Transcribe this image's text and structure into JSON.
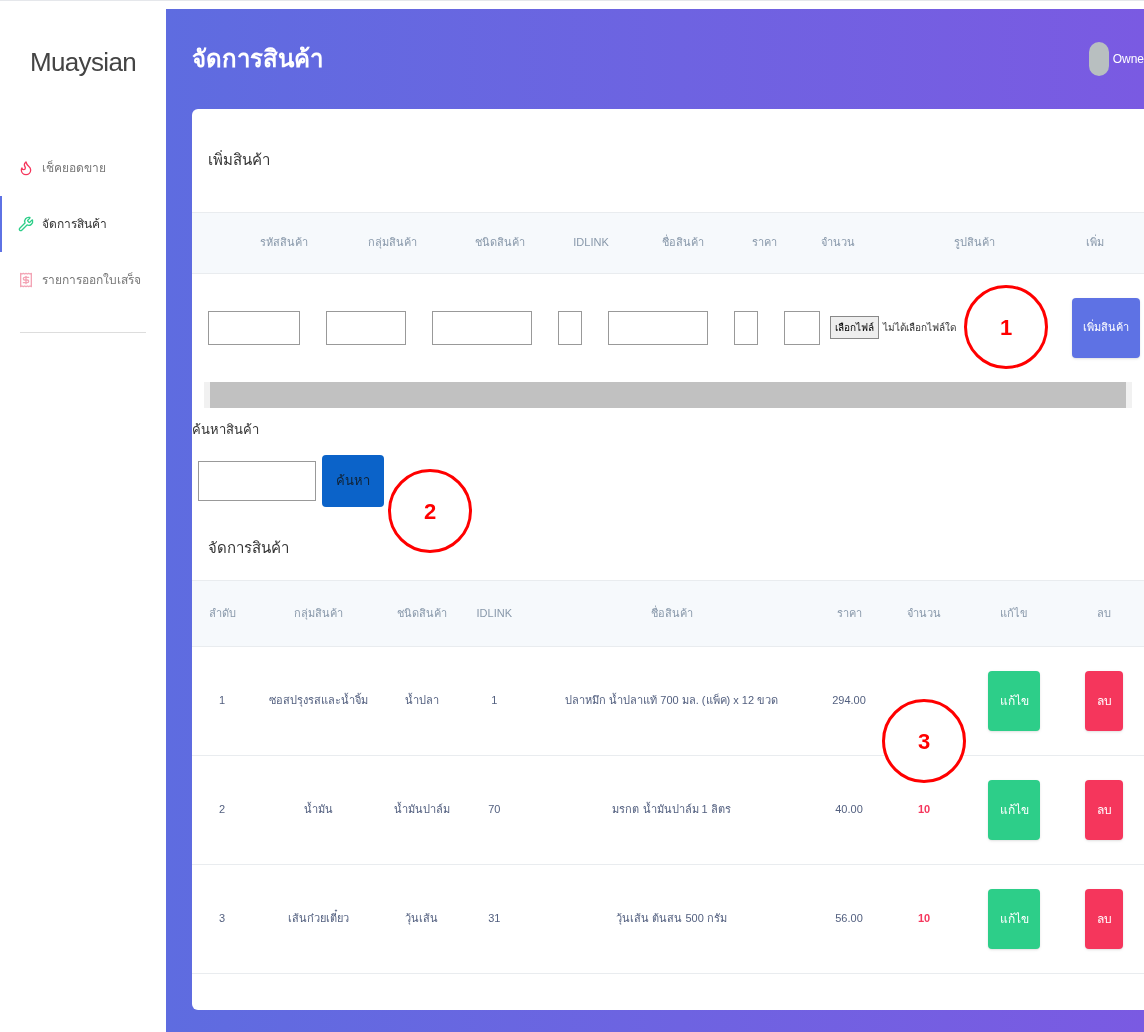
{
  "sidebar": {
    "brand": "Muaysian",
    "items": [
      {
        "label": "เช็คยอดขาย",
        "selected": false
      },
      {
        "label": "จัดการสินค้า",
        "selected": true
      },
      {
        "label": "รายการออกใบเสร็จ",
        "selected": false
      }
    ]
  },
  "header": {
    "title": "จัดการสินค้า",
    "user": "Owne"
  },
  "add_form": {
    "title": "เพิ่มสินค้า",
    "columns": [
      "รหัสสินค้า",
      "กลุ่มสินค้า",
      "ชนิดสินค้า",
      "IDLINK",
      "ชื่อสินค้า",
      "ราคา",
      "จำนวน",
      "รูปสินค้า",
      "เพิ่ม"
    ],
    "file_button": "เลือกไฟล์",
    "file_status": "ไม่ได้เลือกไฟล์ใด",
    "submit": "เพิ่มสินค้า"
  },
  "search": {
    "label": "ค้นหาสินค้า",
    "button": "ค้นหา"
  },
  "table": {
    "title": "จัดการสินค้า",
    "columns": [
      "ลำดับ",
      "กลุ่มสินค้า",
      "ชนิดสินค้า",
      "IDLINK",
      "ชื่อสินค้า",
      "ราคา",
      "จำนวน",
      "แก้ไข",
      "ลบ"
    ],
    "rows": [
      {
        "no": "1",
        "group": "ซอสปรุงรสและน้ำจิ้ม",
        "type": "น้ำปลา",
        "idlink": "1",
        "name": "ปลาหมึก น้ำปลาแท้ 700 มล. (แพ็ค) x 12 ขวด",
        "price": "294.00",
        "edit": "แก้ไข",
        "delete": "ลบ"
      },
      {
        "no": "2",
        "group": "น้ำมัน",
        "type": "น้ำมันปาล์ม",
        "idlink": "70",
        "name": "มรกต น้ำมันปาล์ม 1 ลิตร",
        "price": "40.00",
        "qty": "10",
        "low": true,
        "edit": "แก้ไข",
        "delete": "ลบ"
      },
      {
        "no": "3",
        "group": "เส้นก๋วยเตี๋ยว",
        "type": "วุ้นเส้น",
        "idlink": "31",
        "name": "วุ้นเส้น ต้นสน 500 กรัม",
        "price": "56.00",
        "qty": "10",
        "low": true,
        "edit": "แก้ไข",
        "delete": "ลบ"
      }
    ]
  },
  "callouts": [
    "1",
    "2",
    "3"
  ]
}
